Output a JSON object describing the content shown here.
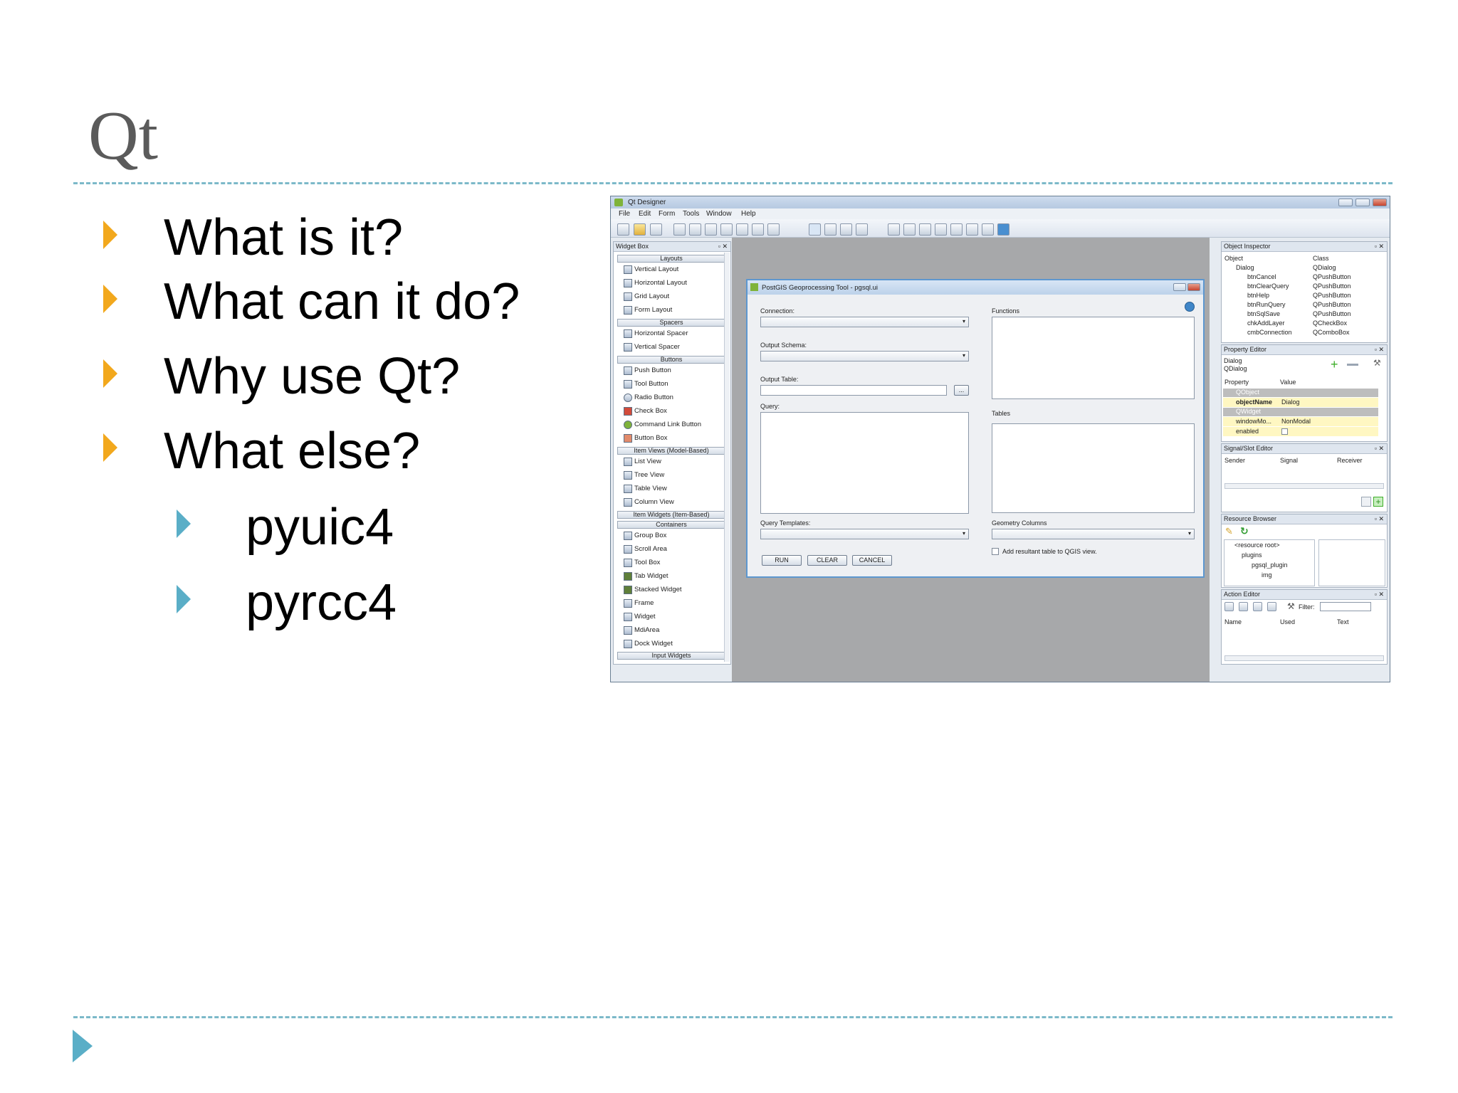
{
  "slide": {
    "title": "Qt",
    "bullets": [
      "What is it?",
      "What can it do?",
      "Why use Qt?",
      "What else?"
    ],
    "sub_bullets": [
      "pyuic4",
      "pyrcc4"
    ]
  },
  "designer": {
    "title": "Qt Designer",
    "menu": [
      "File",
      "Edit",
      "Form",
      "Tools",
      "Window",
      "Help"
    ],
    "widget_box": {
      "title": "Widget Box",
      "categories": [
        "Layouts",
        "Spacers",
        "Buttons",
        "Item Views (Model-Based)",
        "Item Widgets (Item-Based)",
        "Containers",
        "Input Widgets"
      ],
      "layouts": [
        "Vertical Layout",
        "Horizontal Layout",
        "Grid Layout",
        "Form Layout"
      ],
      "spacers": [
        "Horizontal Spacer",
        "Vertical Spacer"
      ],
      "buttons": [
        "Push Button",
        "Tool Button",
        "Radio Button",
        "Check Box",
        "Command Link Button",
        "Button Box"
      ],
      "item_views": [
        "List View",
        "Tree View",
        "Table View",
        "Column View"
      ],
      "containers": [
        "Group Box",
        "Scroll Area",
        "Tool Box",
        "Tab Widget",
        "Stacked Widget",
        "Frame",
        "Widget",
        "MdiArea",
        "Dock Widget"
      ]
    },
    "dialog": {
      "title": "PostGIS Geoprocessing Tool - pgsql.ui",
      "connection": "Connection:",
      "output_schema": "Output Schema:",
      "output_table": "Output Table:",
      "browse": "...",
      "query": "Query:",
      "query_templates": "Query Templates:",
      "functions": "Functions",
      "tables": "Tables",
      "geometry_columns": "Geometry Columns",
      "add_table": "Add resultant table to QGIS view.",
      "run": "RUN",
      "clear": "CLEAR",
      "cancel": "CANCEL"
    },
    "object_inspector": {
      "title": "Object Inspector",
      "col_object": "Object",
      "col_class": "Class",
      "rows": [
        {
          "object": "Dialog",
          "class": "QDialog"
        },
        {
          "object": "btnCancel",
          "class": "QPushButton"
        },
        {
          "object": "btnClearQuery",
          "class": "QPushButton"
        },
        {
          "object": "btnHelp",
          "class": "QPushButton"
        },
        {
          "object": "btnRunQuery",
          "class": "QPushButton"
        },
        {
          "object": "btnSqlSave",
          "class": "QPushButton"
        },
        {
          "object": "chkAddLayer",
          "class": "QCheckBox"
        },
        {
          "object": "cmbConnection",
          "class": "QComboBox"
        }
      ]
    },
    "property_editor": {
      "title": "Property Editor",
      "obj": "Dialog",
      "cls": "QDialog",
      "col_property": "Property",
      "col_value": "Value",
      "group1": "QObject",
      "objectname_label": "objectName",
      "objectname_value": "Dialog",
      "group2": "QWidget",
      "windowmod_label": "windowMo...",
      "windowmod_value": "NonModal",
      "enabled_label": "enabled"
    },
    "signal_slot": {
      "title": "Signal/Slot Editor",
      "sender": "Sender",
      "signal": "Signal",
      "receiver": "Receiver"
    },
    "resource_browser": {
      "title": "Resource Browser",
      "items": [
        "<resource root>",
        "plugins",
        "pgsql_plugin",
        "img"
      ]
    },
    "action_editor": {
      "title": "Action Editor",
      "filter": "Filter:",
      "name": "Name",
      "used": "Used",
      "text": "Text"
    }
  }
}
